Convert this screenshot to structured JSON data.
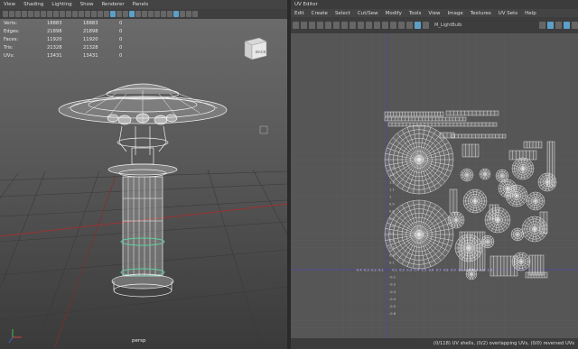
{
  "viewport": {
    "menu": [
      "View",
      "Shading",
      "Lighting",
      "Show",
      "Renderer",
      "Panels"
    ],
    "stats": [
      {
        "label": "Verts:",
        "v1": "18883",
        "v2": "18883",
        "v3": "0"
      },
      {
        "label": "Edges:",
        "v1": "21898",
        "v2": "21898",
        "v3": "0"
      },
      {
        "label": "Faces:",
        "v1": "11920",
        "v2": "11920",
        "v3": "0"
      },
      {
        "label": "Tris:",
        "v1": "21328",
        "v2": "21328",
        "v3": "0"
      },
      {
        "label": "UVs:",
        "v1": "13431",
        "v2": "13431",
        "v3": "0"
      }
    ],
    "view_cube_label": "BACK",
    "camera_label": "persp"
  },
  "uv_editor": {
    "title": "UV Editor",
    "menu": [
      "Edit",
      "Create",
      "Select",
      "Cut/Sew",
      "Modify",
      "Tools",
      "View",
      "Image",
      "Textures",
      "UV Sets",
      "Help"
    ],
    "texture_name": "M_LightBulb",
    "status": "(0/118) UV shells, (0/2) overlapping UVs, (0/0) reversed UVs",
    "y_axis_ticks": [
      "1.4",
      "1.3",
      "1.2",
      "1.1",
      "1",
      "0.9",
      "0.8",
      "0.7",
      "0.6",
      "0.5",
      "0.4",
      "0.3",
      "0.2",
      "0.1",
      "-0.1",
      "-0.2",
      "-0.3",
      "-0.4",
      "-0.5",
      "-0.6"
    ],
    "x_axis_ticks": [
      "-0.4",
      "-0.3",
      "-0.2",
      "-0.1",
      "0.1",
      "0.2",
      "0.3",
      "0.4",
      "0.5",
      "0.6",
      "0.7",
      "0.8",
      "0.9",
      "1",
      "1.1",
      "1.2",
      "1.3",
      "1.4"
    ]
  },
  "colors": {
    "viewport_top": "#6d6d6d",
    "uv_background": "#565656",
    "accent": "#5aa0c8"
  }
}
